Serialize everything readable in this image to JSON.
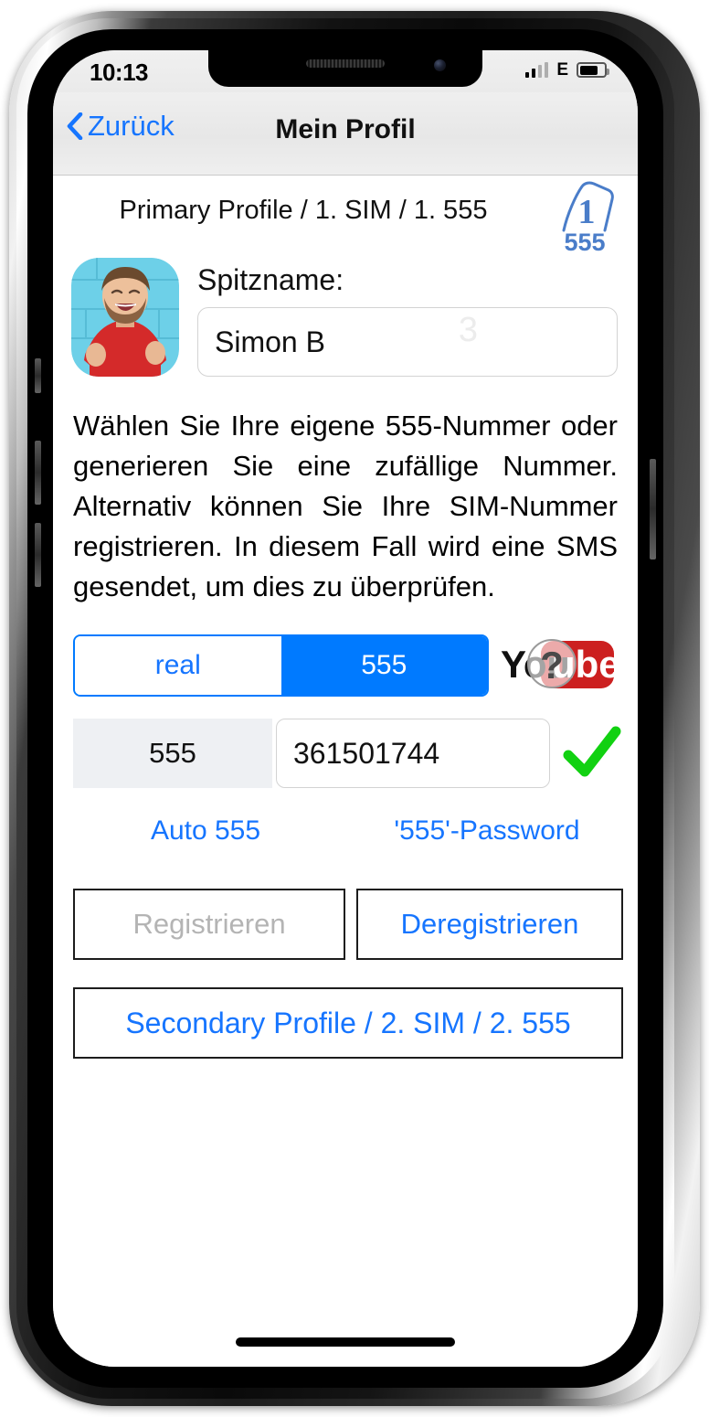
{
  "status_bar": {
    "time": "10:13",
    "network_label": "E",
    "signal_bars_filled": 2,
    "signal_bars_total": 4,
    "battery_percent": 60
  },
  "nav": {
    "back_label": "Zurück",
    "title": "Mein Profil"
  },
  "profile": {
    "header": "Primary Profile / 1. SIM / 1. 555",
    "sim_badge_number": "1",
    "sim_badge_label": "555"
  },
  "nickname": {
    "label": "Spitzname:",
    "value": "Simon B",
    "watermark": "3"
  },
  "description": "Wählen Sie Ihre eigene 555-Nummer oder generieren Sie eine zufällige Nummer. Alternativ können Sie Ihre SIM-Nummer registrieren. In diesem Fall wird eine SMS gesendet, um dies zu überprüfen.",
  "segmented": {
    "option_real": "real",
    "option_555": "555",
    "selected": "555"
  },
  "help": {
    "logo_text_left": "You",
    "logo_text_right": "ube",
    "badge": "?"
  },
  "number": {
    "prefix": "555",
    "value": "361501744",
    "verified": true
  },
  "links": {
    "auto": "Auto 555",
    "password": "'555'-Password"
  },
  "buttons": {
    "register": "Registrieren",
    "register_enabled": false,
    "deregister": "Deregistrieren",
    "deregister_enabled": true,
    "secondary_profile": "Secondary Profile / 2. SIM / 2. 555"
  },
  "colors": {
    "accent_blue": "#007AFF",
    "link_blue": "#1675ff",
    "success_green": "#11D111",
    "sim_badge_blue": "#4a7dc9",
    "disabled_gray": "#b4b4b4",
    "youtube_red": "#CC2020"
  }
}
